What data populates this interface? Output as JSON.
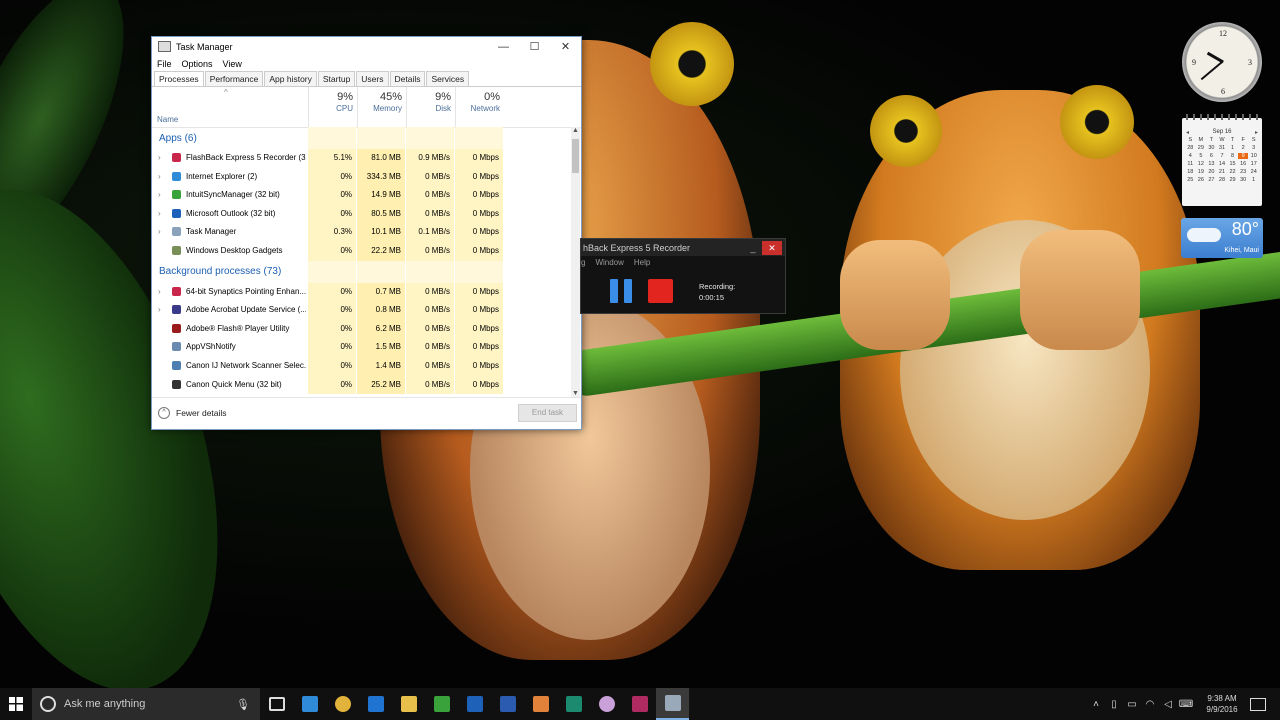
{
  "task_manager": {
    "title": "Task Manager",
    "menu": [
      "File",
      "Options",
      "View"
    ],
    "tabs": [
      "Processes",
      "Performance",
      "App history",
      "Startup",
      "Users",
      "Details",
      "Services"
    ],
    "active_tab": "Processes",
    "columns": {
      "name": "Name",
      "cpu": {
        "label": "CPU",
        "pct": "9%"
      },
      "memory": {
        "label": "Memory",
        "pct": "45%"
      },
      "disk": {
        "label": "Disk",
        "pct": "9%"
      },
      "network": {
        "label": "Network",
        "pct": "0%"
      }
    },
    "groups": [
      {
        "label": "Apps (6)",
        "rows": [
          {
            "name": "FlashBack Express 5 Recorder (3...",
            "cpu": "5.1%",
            "memory": "81.0 MB",
            "disk": "0.9 MB/s",
            "network": "0 Mbps",
            "icon_color": "#c8264b",
            "expand": true
          },
          {
            "name": "Internet Explorer (2)",
            "cpu": "0%",
            "memory": "334.3 MB",
            "disk": "0 MB/s",
            "network": "0 Mbps",
            "icon_color": "#2f8ad8",
            "expand": true
          },
          {
            "name": "IntuitSyncManager (32 bit)",
            "cpu": "0%",
            "memory": "14.9 MB",
            "disk": "0 MB/s",
            "network": "0 Mbps",
            "icon_color": "#3aa23a",
            "expand": true
          },
          {
            "name": "Microsoft Outlook (32 bit)",
            "cpu": "0%",
            "memory": "80.5 MB",
            "disk": "0 MB/s",
            "network": "0 Mbps",
            "icon_color": "#1d62b8",
            "expand": true
          },
          {
            "name": "Task Manager",
            "cpu": "0.3%",
            "memory": "10.1 MB",
            "disk": "0.1 MB/s",
            "network": "0 Mbps",
            "icon_color": "#8aa2bb",
            "expand": true
          },
          {
            "name": "Windows Desktop Gadgets",
            "cpu": "0%",
            "memory": "22.2 MB",
            "disk": "0 MB/s",
            "network": "0 Mbps",
            "icon_color": "#7a8f58",
            "expand": false
          }
        ]
      },
      {
        "label": "Background processes (73)",
        "rows": [
          {
            "name": "64-bit Synaptics Pointing Enhan...",
            "cpu": "0%",
            "memory": "0.7 MB",
            "disk": "0 MB/s",
            "network": "0 Mbps",
            "icon_color": "#c8264b",
            "expand": true
          },
          {
            "name": "Adobe Acrobat Update Service (...",
            "cpu": "0%",
            "memory": "0.8 MB",
            "disk": "0 MB/s",
            "network": "0 Mbps",
            "icon_color": "#3a3a8a",
            "expand": true
          },
          {
            "name": "Adobe® Flash® Player Utility",
            "cpu": "0%",
            "memory": "6.2 MB",
            "disk": "0 MB/s",
            "network": "0 Mbps",
            "icon_color": "#9a1b1b",
            "expand": false
          },
          {
            "name": "AppVShNotify",
            "cpu": "0%",
            "memory": "1.5 MB",
            "disk": "0 MB/s",
            "network": "0 Mbps",
            "icon_color": "#6a8ab0",
            "expand": false
          },
          {
            "name": "Canon IJ Network Scanner Selec...",
            "cpu": "0%",
            "memory": "1.4 MB",
            "disk": "0 MB/s",
            "network": "0 Mbps",
            "icon_color": "#4f7fb0",
            "expand": false
          },
          {
            "name": "Canon Quick Menu (32 bit)",
            "cpu": "0%",
            "memory": "25.2 MB",
            "disk": "0 MB/s",
            "network": "0 Mbps",
            "icon_color": "#333333",
            "expand": false
          }
        ]
      }
    ],
    "footer": {
      "fewer_details": "Fewer details",
      "end_task": "End task"
    }
  },
  "recorder": {
    "title": "hBack Express 5 Recorder",
    "menu": [
      "g",
      "Window",
      "Help"
    ],
    "status_label": "Recording:",
    "status_time": "0:00:15"
  },
  "gadgets": {
    "calendar": {
      "month": "Sep 16",
      "weekdays": [
        "S",
        "M",
        "T",
        "W",
        "T",
        "F",
        "S"
      ],
      "days": [
        "28",
        "29",
        "30",
        "31",
        "1",
        "2",
        "3",
        "4",
        "5",
        "6",
        "7",
        "8",
        "9",
        "10",
        "11",
        "12",
        "13",
        "14",
        "15",
        "16",
        "17",
        "18",
        "19",
        "20",
        "21",
        "22",
        "23",
        "24",
        "25",
        "26",
        "27",
        "28",
        "29",
        "30",
        "1"
      ],
      "today": "9"
    },
    "weather": {
      "temp": "80°",
      "location": "Kihei, Maui"
    }
  },
  "taskbar": {
    "search_placeholder": "Ask me anything",
    "time": "9:38 AM",
    "date": "9/9/2016",
    "pinned": [
      {
        "name": "task-view",
        "color": "#dddddd"
      },
      {
        "name": "internet-explorer",
        "color": "#2f8ad8"
      },
      {
        "name": "chrome",
        "color": "#e2b33a"
      },
      {
        "name": "edge",
        "color": "#1e74d0"
      },
      {
        "name": "file-explorer",
        "color": "#e6c04a"
      },
      {
        "name": "quickbooks",
        "color": "#3aa23a"
      },
      {
        "name": "outlook",
        "color": "#1d62b8"
      },
      {
        "name": "word",
        "color": "#2a5bb0"
      },
      {
        "name": "paint",
        "color": "#e0823a"
      },
      {
        "name": "store",
        "color": "#1b8a6e"
      },
      {
        "name": "picasa",
        "color": "#c9a0d8"
      },
      {
        "name": "flashback",
        "color": "#b02a62"
      },
      {
        "name": "task-manager",
        "color": "#9aa9ba"
      }
    ]
  }
}
